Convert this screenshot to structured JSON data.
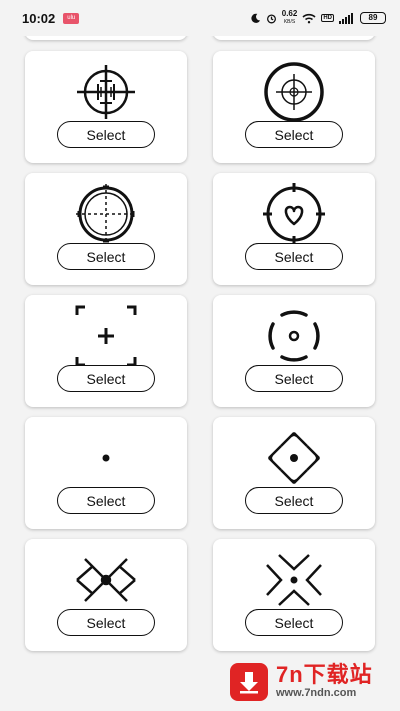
{
  "status_bar": {
    "time": "10:02",
    "app_badge": "ulu",
    "net_speed": "0.62",
    "net_unit": "KB/S",
    "hd": "HD",
    "battery": "89"
  },
  "select_label": "Select",
  "crosshairs": [
    {
      "icon": "crosshair-scope-ticks-icon",
      "label": "Select"
    },
    {
      "icon": "crosshair-double-ring-icon",
      "label": "Select"
    },
    {
      "icon": "crosshair-dashed-scope-icon",
      "label": "Select"
    },
    {
      "icon": "crosshair-heart-icon",
      "label": "Select"
    },
    {
      "icon": "crosshair-corner-brackets-icon",
      "label": "Select"
    },
    {
      "icon": "crosshair-broken-circle-icon",
      "label": "Select"
    },
    {
      "icon": "crosshair-dot-icon",
      "label": "Select"
    },
    {
      "icon": "crosshair-diamond-icon",
      "label": "Select"
    },
    {
      "icon": "crosshair-x-diamond-icon",
      "label": "Select"
    },
    {
      "icon": "crosshair-x-arrows-icon",
      "label": "Select"
    }
  ],
  "watermark": {
    "title": "7n下载站",
    "url": "www.7ndn.com"
  },
  "colors": {
    "background": "#f3f3f3",
    "card": "#ffffff",
    "icon": "#111111",
    "watermark_red": "#e02424"
  }
}
